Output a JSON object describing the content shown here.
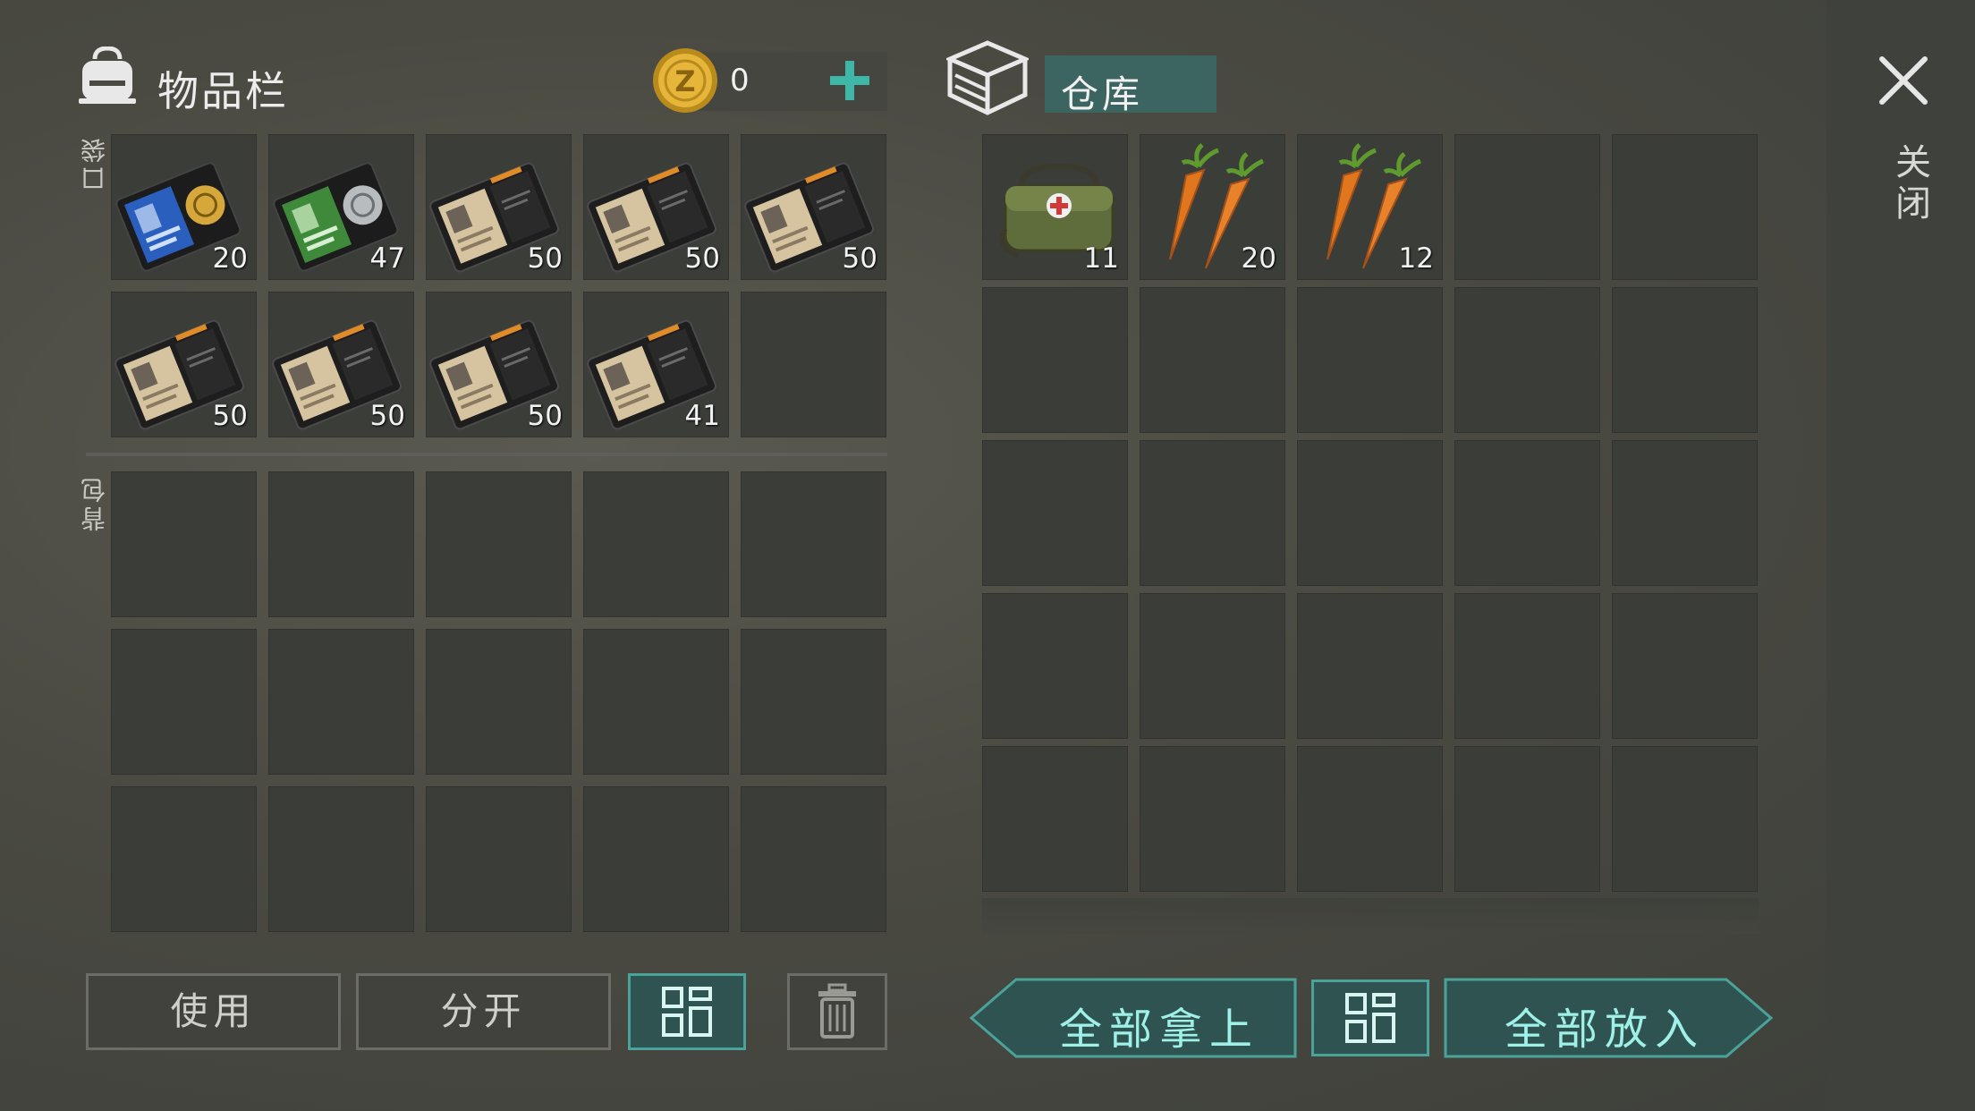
{
  "inventory": {
    "title": "物品栏",
    "coin_count": "0",
    "pocket_label": "口袋",
    "backpack_label": "背包",
    "pocket_items": [
      {
        "icon": "police-badge-wallet-gold-icon",
        "qty": "20"
      },
      {
        "icon": "police-badge-wallet-silver-icon",
        "qty": "47"
      },
      {
        "icon": "patrol-officer-id-icon",
        "qty": "50"
      },
      {
        "icon": "patrol-officer-id-icon",
        "qty": "50"
      },
      {
        "icon": "patrol-officer-id-icon",
        "qty": "50"
      },
      {
        "icon": "patrol-officer-id-icon",
        "qty": "50"
      },
      {
        "icon": "patrol-officer-id-icon",
        "qty": "50"
      },
      {
        "icon": "patrol-officer-id-icon",
        "qty": "50"
      },
      {
        "icon": "patrol-officer-id-icon",
        "qty": "41"
      },
      {
        "icon": "",
        "qty": ""
      }
    ]
  },
  "warehouse": {
    "title": "仓库",
    "items": [
      {
        "icon": "medical-bag-icon",
        "qty": "11"
      },
      {
        "icon": "carrots-icon",
        "qty": "20"
      },
      {
        "icon": "carrots-icon",
        "qty": "12"
      }
    ]
  },
  "close_label": "关闭",
  "buttons": {
    "use": "使用",
    "split": "分开",
    "take_all": "全部拿上",
    "put_all": "全部放入"
  },
  "colors": {
    "accent_teal": "#3c6460",
    "accent_text": "#9ff0e6",
    "coin_gold": "#e0b030"
  }
}
